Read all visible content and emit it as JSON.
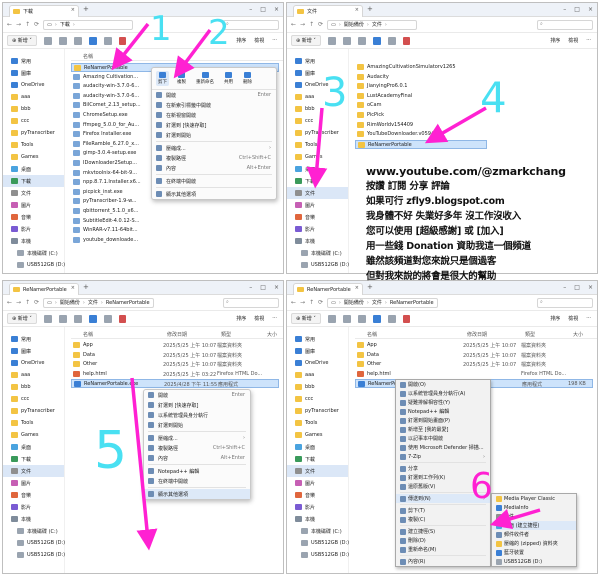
{
  "common": {
    "new_label": "新增",
    "sort_label": "排序",
    "view_label": "檢視",
    "more_label": "···",
    "this_pc_label": "本機",
    "col_name": "名稱",
    "col_modified": "修改日期",
    "col_type": "類型",
    "col_size": "大小"
  },
  "sidebar": [
    "常用",
    "圖庫",
    "OneDrive",
    "aaa",
    "bbb",
    "ccc",
    "pyTranscriber",
    "Tools",
    "Games",
    "桌面",
    "下載",
    "文件",
    "圖片",
    "音樂",
    "影片",
    "本機",
    "本機磁碟 (C:)",
    "USB512GB (D:)",
    "USB512GB (D:)"
  ],
  "panel1": {
    "tab_title": "下載",
    "crumbs": [
      "下載"
    ],
    "selected_sidebar": 10,
    "files": [
      "ReNamerPortable",
      "Amazing Cultivation...",
      "audacity-win-3.7.0-6...",
      "audacity-win-3.7.0-6...",
      "BilComet_2.13_setup...",
      "ChromeSetup.exe",
      "ffmpeg_5.0.0_for_Au...",
      "Firefox Installer.exe",
      "FileRamble_6.27.0_x...",
      "gimp-3.0.4-setup.exe",
      "IDownloader2Setup...",
      "mkvtoolnix-64-bit-9...",
      "npp.8.7.1.Installer.x6...",
      "picpick_inst.exe",
      "pyTranscriber-1.9-w...",
      "qbittorrent_5.1.0_x6...",
      "SubtitleEdit-4.0.12-S...",
      "WinRAR-v7.11-64bit...",
      "youtube_downloade..."
    ],
    "ctx_top": [
      "剪下",
      "複製",
      "重新命名",
      "共用",
      "刪除"
    ],
    "ctx_items": [
      {
        "label": "開啟",
        "shortcut": "Enter"
      },
      {
        "label": "在新索引標籤中開啟",
        "shortcut": ""
      },
      {
        "label": "在新視窗開啟",
        "shortcut": ""
      },
      {
        "label": "釘選到 [快速存取]",
        "shortcut": ""
      },
      {
        "label": "釘選到開始",
        "shortcut": ""
      },
      {
        "label": "壓縮成...",
        "shortcut": "›"
      },
      {
        "label": "複製路徑",
        "shortcut": "Ctrl+Shift+C"
      },
      {
        "label": "內容",
        "shortcut": "Alt+Enter"
      },
      {
        "label": "在終端中開啟",
        "shortcut": ""
      },
      {
        "label": "顯示其他選項",
        "shortcut": ""
      }
    ],
    "steps": [
      "1",
      "2"
    ]
  },
  "panel2": {
    "tab_title": "文件",
    "crumbs": [
      "開始備份",
      "文件"
    ],
    "selected_sidebar": 11,
    "files": [
      "AmazingCultivationSimulatorv1265",
      "Audacity",
      "JianyingPro6.0.1",
      "LustAcademyFinal",
      "oCam",
      "PicPick",
      "RimWorldv154409",
      "YouTubeDownloader.v05940",
      "ReNamerPortable"
    ],
    "steps": [
      "3",
      "4"
    ],
    "info_lines": [
      "www.youtube.com/@zmarkchang",
      "按讚 訂閱 分享 評論",
      "如果可行 zfly9.blogspot.com",
      "我身體不好 失業好多年 沒工作沒收入",
      "您可以使用 [超級感謝] 或 [加入]",
      "用一些錢 Donation 資助我這一個頻道",
      "雖然該頻道對您來說只是個過客",
      "但對我來說的將會是很大的幫助"
    ]
  },
  "panel3": {
    "tab_title": "ReNamerPortable",
    "crumbs": [
      "開始備份",
      "文件",
      "ReNamerPortable"
    ],
    "selected_sidebar": 11,
    "files": [
      {
        "name": "App",
        "modified": "2025/5/25 上午 10:07",
        "type": "檔案資料夾",
        "size": ""
      },
      {
        "name": "Data",
        "modified": "2025/5/25 上午 10:07",
        "type": "檔案資料夾",
        "size": ""
      },
      {
        "name": "Other",
        "modified": "2025/5/25 上午 10:07",
        "type": "檔案資料夾",
        "size": ""
      },
      {
        "name": "help.html",
        "modified": "2025/5/25 上午 03:22",
        "type": "Firefox HTML Do...",
        "size": ""
      },
      {
        "name": "ReNamerPortable.exe",
        "modified": "2025/4/28 下午 11:55",
        "type": "應用程式",
        "size": ""
      }
    ],
    "ctx_items": [
      {
        "label": "開啟",
        "shortcut": "Enter"
      },
      {
        "label": "釘選到 [快速存取]",
        "shortcut": ""
      },
      {
        "label": "以系統管理員身分執行",
        "shortcut": ""
      },
      {
        "label": "釘選到開始",
        "shortcut": ""
      },
      {
        "label": "壓縮成...",
        "shortcut": "›"
      },
      {
        "label": "複製路徑",
        "shortcut": "Ctrl+Shift+C"
      },
      {
        "label": "內容",
        "shortcut": "Alt+Enter"
      },
      {
        "label": "Notepad++ 編輯",
        "shortcut": ""
      },
      {
        "label": "在終端中開啟",
        "shortcut": ""
      },
      {
        "label": "顯示其他選項",
        "shortcut": ""
      }
    ],
    "steps": [
      "5"
    ]
  },
  "panel4": {
    "tab_title": "ReNamerPortable",
    "crumbs": [
      "開始備份",
      "文件",
      "ReNamerPortable"
    ],
    "selected_sidebar": 11,
    "files": [
      {
        "name": "App",
        "modified": "2025/5/25 上午 10:07",
        "type": "檔案資料夾",
        "size": ""
      },
      {
        "name": "Data",
        "modified": "2025/5/25 上午 10:07",
        "type": "檔案資料夾",
        "size": ""
      },
      {
        "name": "Other",
        "modified": "2025/5/25 上午 10:07",
        "type": "檔案資料夾",
        "size": ""
      },
      {
        "name": "help.html",
        "modified": "",
        "type": "Firefox HTML Do...",
        "size": ""
      },
      {
        "name": "ReNamerPortable.exe",
        "modified": "",
        "type": "應用程式",
        "size": "198 KB"
      }
    ],
    "ctx_items": [
      {
        "label": "開啟(O)",
        "shortcut": ""
      },
      {
        "label": "以系統管理員身分執行(A)",
        "shortcut": ""
      },
      {
        "label": "疑難排解相容性(Y)",
        "shortcut": ""
      },
      {
        "label": "Notepad++ 編輯",
        "shortcut": ""
      },
      {
        "label": "釘選到開始畫面(P)",
        "shortcut": ""
      },
      {
        "label": "新增至 [我的最愛]",
        "shortcut": ""
      },
      {
        "label": "以記事本中開啟",
        "shortcut": ""
      },
      {
        "label": "使用 Microsoft Defender 掃描...",
        "shortcut": ""
      },
      {
        "label": "7-Zip",
        "shortcut": "›"
      },
      {
        "label": "分享",
        "shortcut": ""
      },
      {
        "label": "釘選到工作列(K)",
        "shortcut": ""
      },
      {
        "label": "還原舊版(V)",
        "shortcut": ""
      },
      {
        "label": "傳送到(N)",
        "shortcut": "›"
      },
      {
        "label": "剪下(T)",
        "shortcut": ""
      },
      {
        "label": "複製(C)",
        "shortcut": ""
      },
      {
        "label": "建立捷徑(S)",
        "shortcut": ""
      },
      {
        "label": "刪除(D)",
        "shortcut": ""
      },
      {
        "label": "重新命名(M)",
        "shortcut": ""
      },
      {
        "label": "內容(R)",
        "shortcut": ""
      }
    ],
    "sendto_items": [
      "Media Player Classic",
      "MediaInfo",
      "文件",
      "桌面 (建立捷徑)",
      "郵件收件者",
      "壓縮的 (zipped) 資料夾",
      "藍牙裝置",
      "USB512GB (D:)"
    ],
    "steps": [
      "6"
    ]
  },
  "colors": {
    "arrow": "#ff21d2",
    "step_number": "#49e0f2",
    "step_number_alt": "#ff21d2",
    "selection": "#cde3fb",
    "folder": "#f3c443"
  }
}
